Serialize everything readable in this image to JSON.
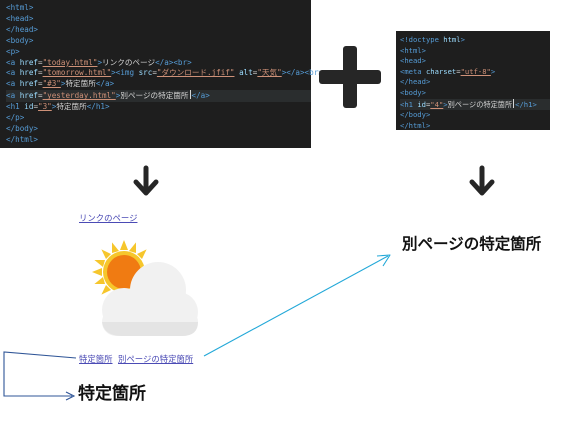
{
  "left_code": {
    "lines": [
      [
        {
          "c": "t",
          "v": "<html>"
        }
      ],
      [
        {
          "c": "t",
          "v": "<head>"
        }
      ],
      [
        {
          "c": "t",
          "v": "</head>"
        }
      ],
      [
        {
          "c": "t",
          "v": "<body>"
        }
      ],
      [
        {
          "c": "t",
          "v": "<p>"
        }
      ],
      [
        {
          "c": "t",
          "v": "<a "
        },
        {
          "c": "a",
          "v": "href"
        },
        {
          "c": "txt",
          "v": "="
        },
        {
          "c": "s",
          "v": "\"today.html\""
        },
        {
          "c": "t",
          "v": ">"
        },
        {
          "c": "txt",
          "v": "リンクのページ"
        },
        {
          "c": "t",
          "v": "</a><br>"
        }
      ],
      [
        {
          "c": "t",
          "v": "<a "
        },
        {
          "c": "a",
          "v": "href"
        },
        {
          "c": "txt",
          "v": "="
        },
        {
          "c": "s",
          "v": "\"tomorrow.html\""
        },
        {
          "c": "t",
          "v": "><img "
        },
        {
          "c": "a",
          "v": "src"
        },
        {
          "c": "txt",
          "v": "="
        },
        {
          "c": "s",
          "v": "\"ダウンロード.jfif\""
        },
        {
          "c": "txt",
          "v": " "
        },
        {
          "c": "a",
          "v": "alt"
        },
        {
          "c": "txt",
          "v": "="
        },
        {
          "c": "s",
          "v": "\"天気\""
        },
        {
          "c": "t",
          "v": "></a><br>"
        }
      ],
      [
        {
          "c": "t",
          "v": "<a "
        },
        {
          "c": "a",
          "v": "href"
        },
        {
          "c": "txt",
          "v": "="
        },
        {
          "c": "s",
          "v": "\"#3\""
        },
        {
          "c": "t",
          "v": ">"
        },
        {
          "c": "txt",
          "v": "特定箇所"
        },
        {
          "c": "t",
          "v": "</a>"
        }
      ],
      [
        {
          "c": "t",
          "v": "<a "
        },
        {
          "c": "a",
          "v": "href"
        },
        {
          "c": "txt",
          "v": "="
        },
        {
          "c": "s",
          "v": "\"yesterday.html\""
        },
        {
          "c": "t",
          "v": ">"
        },
        {
          "c": "txt",
          "v": "別ページの特定箇所"
        },
        {
          "c": "cursor",
          "v": ""
        },
        {
          "c": "t",
          "v": "</a>"
        }
      ],
      [
        {
          "c": "t",
          "v": "<h1 "
        },
        {
          "c": "a",
          "v": "id"
        },
        {
          "c": "txt",
          "v": "="
        },
        {
          "c": "s",
          "v": "\"3\""
        },
        {
          "c": "t",
          "v": ">"
        },
        {
          "c": "txt",
          "v": "特定箇所"
        },
        {
          "c": "t",
          "v": "</h1>"
        }
      ],
      [
        {
          "c": "t",
          "v": "</p>"
        }
      ],
      [
        {
          "c": "t",
          "v": "</body>"
        }
      ],
      [
        {
          "c": "t",
          "v": "</html>"
        }
      ]
    ]
  },
  "right_code": {
    "lines": [
      [
        {
          "c": "t",
          "v": "<!doctype "
        },
        {
          "c": "a",
          "v": "html"
        },
        {
          "c": "t",
          "v": ">"
        }
      ],
      [
        {
          "c": "t",
          "v": "<html>"
        }
      ],
      [
        {
          "c": "t",
          "v": "<head>"
        }
      ],
      [
        {
          "c": "t",
          "v": "<meta "
        },
        {
          "c": "a",
          "v": "charset"
        },
        {
          "c": "txt",
          "v": "="
        },
        {
          "c": "s",
          "v": "\"utf-8\""
        },
        {
          "c": "t",
          "v": ">"
        }
      ],
      [
        {
          "c": "t",
          "v": "</head>"
        }
      ],
      [
        {
          "c": "t",
          "v": "<body>"
        }
      ],
      [
        {
          "c": "t",
          "v": "<h1 "
        },
        {
          "c": "a",
          "v": "id"
        },
        {
          "c": "txt",
          "v": "="
        },
        {
          "c": "s",
          "v": "\"4\""
        },
        {
          "c": "t",
          "v": ">"
        },
        {
          "c": "txt",
          "v": "別ページの特定箇所"
        },
        {
          "c": "cursor",
          "v": ""
        },
        {
          "c": "t",
          "v": "</h1>"
        }
      ],
      [
        {
          "c": "t",
          "v": "</body>"
        }
      ],
      [
        {
          "c": "t",
          "v": "</html>"
        }
      ]
    ]
  },
  "rendered_left": {
    "link_page": "リンクのページ",
    "link_anchor": "特定箇所",
    "link_other_page": "別ページの特定箇所",
    "heading": "特定箇所"
  },
  "rendered_right": {
    "heading": "別ページの特定箇所"
  },
  "icons": {
    "plus": "plus-icon",
    "down_arrow": "arrow-down-icon",
    "weather": "sun-cloud-icon"
  },
  "colors": {
    "link": "#4b4bb5",
    "connector": "#22a8d8",
    "bracket": "#2f5597",
    "code_bg": "#1e1e1e"
  }
}
